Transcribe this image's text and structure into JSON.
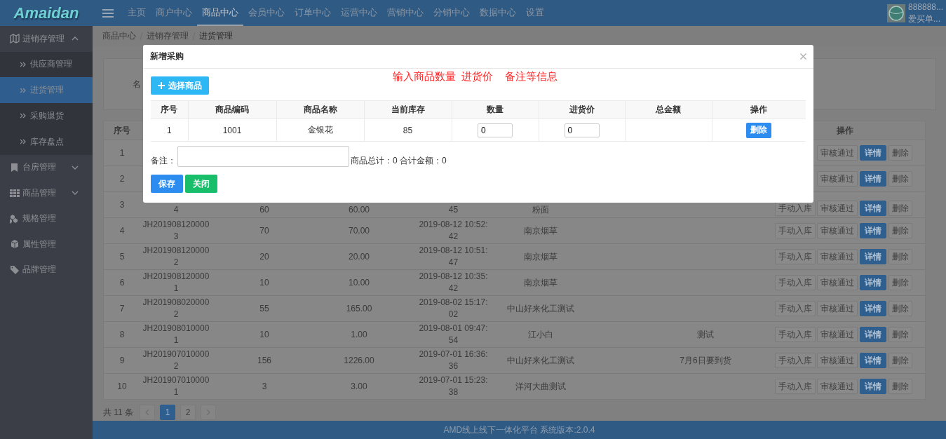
{
  "app": {
    "logo": "Amaidan",
    "nav": [
      {
        "label": "主页",
        "selected": false
      },
      {
        "label": "商户中心",
        "selected": false
      },
      {
        "label": "商品中心",
        "selected": true
      },
      {
        "label": "会员中心",
        "selected": false
      },
      {
        "label": "订单中心",
        "selected": false
      },
      {
        "label": "运营中心",
        "selected": false
      },
      {
        "label": "营销中心",
        "selected": false
      },
      {
        "label": "分销中心",
        "selected": false
      },
      {
        "label": "数据中心",
        "selected": false
      },
      {
        "label": "设置",
        "selected": false
      }
    ],
    "user": {
      "name": "888888...",
      "shop": "爱买单..."
    }
  },
  "sidebar": {
    "items": [
      {
        "label": "进销存管理",
        "expanded": true,
        "children": [
          {
            "label": "供应商管理",
            "selected": false
          },
          {
            "label": "进货管理",
            "selected": true
          },
          {
            "label": "采购退货",
            "selected": false
          },
          {
            "label": "库存盘点",
            "selected": false
          }
        ]
      },
      {
        "label": "台房管理",
        "expanded": false
      },
      {
        "label": "商品管理",
        "expanded": false
      },
      {
        "label": "规格管理"
      },
      {
        "label": "属性管理"
      },
      {
        "label": "品牌管理"
      }
    ]
  },
  "breadcrumb": [
    "商品中心",
    "进销存管理",
    "进货管理"
  ],
  "search": {
    "label": "名"
  },
  "table": {
    "header_first": "序号",
    "header_last": "操作",
    "rows": [
      {
        "column_1": "1",
        "actions": [
          {
            "label": "审核通过",
            "disabled": true
          },
          {
            "label": "详情",
            "disabled": false
          },
          {
            "label": "删除",
            "disabled": true
          }
        ]
      },
      {
        "column_1": "2",
        "actions": [
          {
            "label": "审核通过",
            "disabled": true
          },
          {
            "label": "详情",
            "disabled": false
          },
          {
            "label": "删除",
            "disabled": true
          }
        ]
      },
      {
        "column_1": "3",
        "clipped": true,
        "column_2": "4",
        "column_3": "60",
        "column_4": "60.00",
        "column_5": "45",
        "column_6": "粉面",
        "actions": [
          {
            "label": "手动入库",
            "disabled": true
          },
          {
            "label": "审核通过",
            "disabled": true
          },
          {
            "label": "详情",
            "disabled": false
          },
          {
            "label": "删除",
            "disabled": true
          }
        ]
      },
      {
        "column_1": "4",
        "column_2": "JH2019081200003",
        "column_3": "70",
        "column_4": "70.00",
        "column_5": "2019-08-12 10:52:42",
        "column_6": "南京烟草",
        "actions": [
          {
            "label": "手动入库",
            "disabled": true
          },
          {
            "label": "审核通过",
            "disabled": true
          },
          {
            "label": "详情",
            "disabled": false
          },
          {
            "label": "删除",
            "disabled": true
          }
        ]
      },
      {
        "column_1": "5",
        "column_2": "JH2019081200002",
        "column_3": "20",
        "column_4": "20.00",
        "column_5": "2019-08-12 10:51:47",
        "column_6": "南京烟草",
        "actions": [
          {
            "label": "手动入库",
            "disabled": true
          },
          {
            "label": "审核通过",
            "disabled": true
          },
          {
            "label": "详情",
            "disabled": false
          },
          {
            "label": "删除",
            "disabled": true
          }
        ]
      },
      {
        "column_1": "6",
        "column_2": "JH2019081200001",
        "column_3": "10",
        "column_4": "10.00",
        "column_5": "2019-08-12 10:35:42",
        "column_6": "南京烟草",
        "actions": [
          {
            "label": "手动入库",
            "disabled": true
          },
          {
            "label": "审核通过",
            "disabled": true
          },
          {
            "label": "详情",
            "disabled": false
          },
          {
            "label": "删除",
            "disabled": true
          }
        ]
      },
      {
        "column_1": "7",
        "column_2": "JH2019080200002",
        "column_3": "55",
        "column_4": "165.00",
        "column_5": "2019-08-02 15:17:02",
        "column_6": "中山好来化工测试",
        "actions": [
          {
            "label": "手动入库",
            "disabled": true
          },
          {
            "label": "审核通过",
            "disabled": true
          },
          {
            "label": "详情",
            "disabled": false
          },
          {
            "label": "删除",
            "disabled": true
          }
        ]
      },
      {
        "column_1": "8",
        "column_2": "JH2019080100001",
        "column_3": "10",
        "column_4": "1.00",
        "column_5": "2019-08-01 09:47:54",
        "column_6": "江小白",
        "column_7": "测试",
        "actions": [
          {
            "label": "手动入库",
            "disabled": true
          },
          {
            "label": "审核通过",
            "disabled": true
          },
          {
            "label": "详情",
            "disabled": false
          },
          {
            "label": "删除",
            "disabled": true
          }
        ]
      },
      {
        "column_1": "9",
        "column_2": "JH2019070100002",
        "column_3": "156",
        "column_4": "1226.00",
        "column_5": "2019-07-01 16:36:36",
        "column_6": "中山好来化工测试",
        "column_7": "7月6日要到货",
        "actions": [
          {
            "label": "手动入库",
            "disabled": true
          },
          {
            "label": "审核通过",
            "disabled": true
          },
          {
            "label": "详情",
            "disabled": false
          },
          {
            "label": "删除",
            "disabled": true
          }
        ]
      },
      {
        "column_1": "10",
        "column_2": "JH2019070100001",
        "column_3": "3",
        "column_4": "3.00",
        "column_5": "2019-07-01 15:23:38",
        "column_6": "洋河大曲测试",
        "actions": [
          {
            "label": "手动入库",
            "disabled": true
          },
          {
            "label": "审核通过",
            "disabled": true
          },
          {
            "label": "详情",
            "disabled": false
          },
          {
            "label": "删除",
            "disabled": true
          }
        ]
      }
    ]
  },
  "pagination": {
    "total": "共 11 条",
    "pages": [
      {
        "label": "1",
        "selected": true
      },
      {
        "label": "2",
        "selected": false
      }
    ]
  },
  "footer": "AMD线上线下一体化平台 系统版本:2.0.4",
  "modal": {
    "title": "新增采购",
    "hint": "输入商品数量  进货价    备注等信息",
    "add_button": "选择商品",
    "columns": [
      "序号",
      "商品编码",
      "商品名称",
      "当前库存",
      "数量",
      "进货价",
      "总金额",
      "操作"
    ],
    "rows": [
      {
        "index": "1",
        "code": "1001",
        "name": "金银花",
        "stock": "85",
        "quantity": "0",
        "price": "0",
        "delete_button": "删除"
      }
    ],
    "remark_label": "备注：",
    "summary": "商品总计：0 合计金额：0",
    "save_button": "保存",
    "close_button": "关闭"
  }
}
